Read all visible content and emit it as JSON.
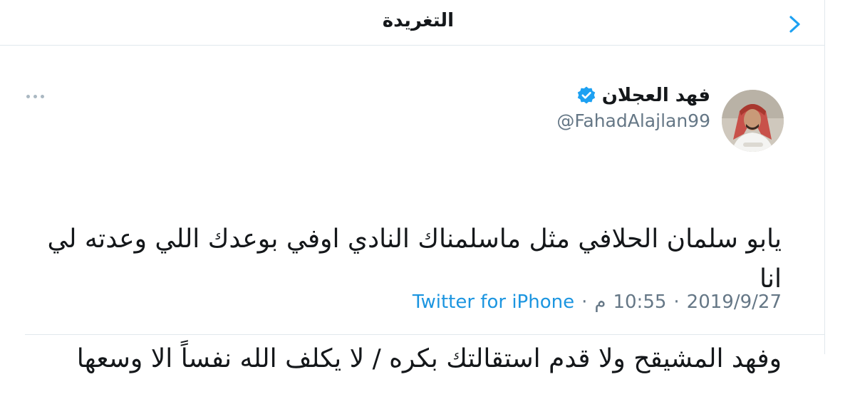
{
  "header": {
    "title": "التغريدة",
    "back_icon": "chevron-right-icon"
  },
  "tweet": {
    "author": {
      "display_name": "فهد العجلان",
      "handle": "@FahadAlajlan99",
      "verified": true
    },
    "text_line1": "يابو سلمان الحلافي مثل ماسلمناك النادي اوفي بوعدك اللي وعدته لي انا",
    "text_line2": "وفهد المشيقح  ولا قدم استقالتك بكره / لا يكلف الله نفساً الا وسعها",
    "date": "2019/9/27",
    "time": "10:55",
    "ampm": "م",
    "source": "Twitter for iPhone",
    "separator": "·"
  },
  "colors": {
    "accent": "#1b95e0",
    "verified": "#1da1f2",
    "secondary_text": "#657786",
    "border": "#e1e8ed"
  }
}
